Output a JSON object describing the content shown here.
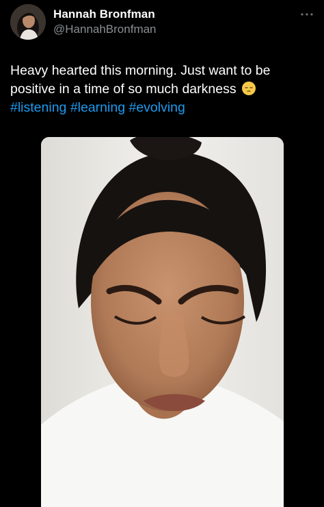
{
  "tweet": {
    "author_name": "Hannah Bronfman",
    "author_handle": "@HannahBronfman",
    "text_line1": "Heavy hearted this morning. Just want to be",
    "text_line2": "positive in a time of so much darkness",
    "hashtags": [
      "#listening",
      "#learning",
      "#evolving"
    ]
  },
  "icons": {
    "more": "more-options-icon",
    "emoji": "pensive-face-emoji"
  },
  "colors": {
    "background": "#000000",
    "text": "#ffffff",
    "secondary_text": "#8b8f93",
    "link": "#1d9bf0"
  }
}
